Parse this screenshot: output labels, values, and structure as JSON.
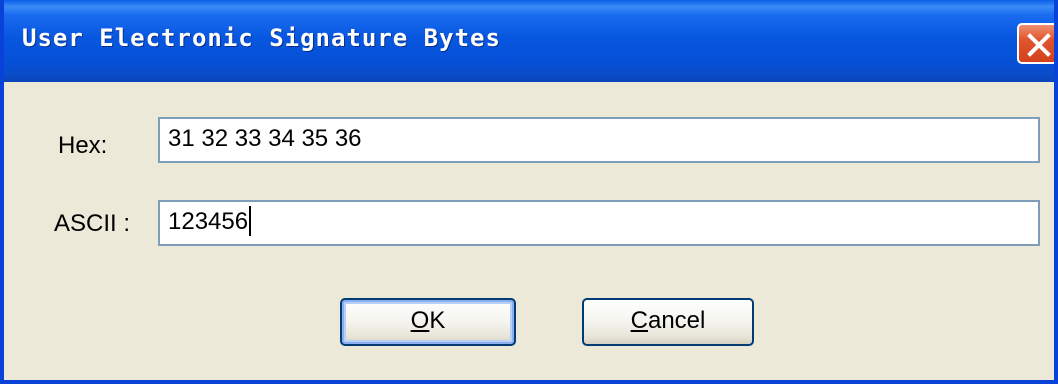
{
  "dialog": {
    "title": "User Electronic Signature Bytes"
  },
  "fields": {
    "hex_label": "Hex:",
    "hex_value": "31 32 33 34 35 36",
    "ascii_label": "ASCII :",
    "ascii_value": "123456"
  },
  "buttons": {
    "ok_mnemonic": "O",
    "ok_rest": "K",
    "cancel_mnemonic": "C",
    "cancel_rest": "ancel"
  },
  "icons": {
    "close": "close-icon"
  },
  "colors": {
    "titlebar": "#0857e0",
    "window_frame": "#0842d8",
    "dialog_background": "#ece9d8",
    "close_button": "#d2421c",
    "textbox_border": "#7f9db9"
  }
}
